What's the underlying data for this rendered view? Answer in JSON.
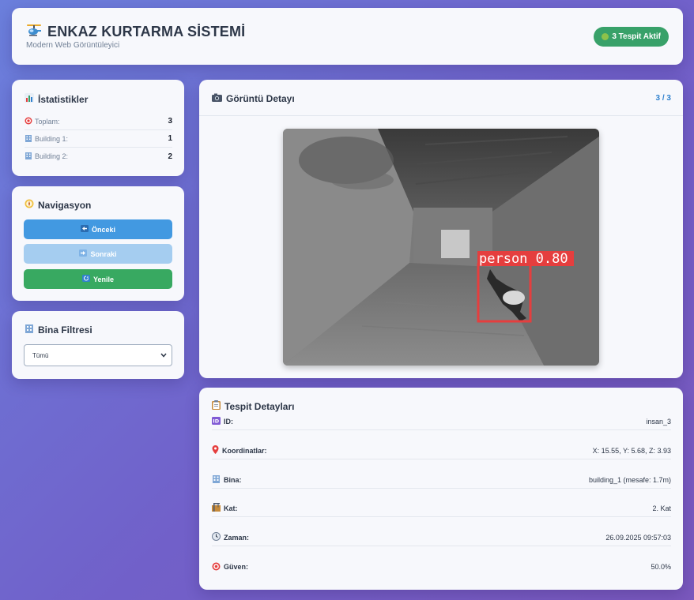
{
  "header": {
    "title": "ENKAZ KURTARMA SİSTEMİ",
    "subtitle": "Modern Web Görüntüleyici",
    "badge": "3 Tespit Aktif",
    "logo_icon": "helicopter-icon"
  },
  "stats": {
    "title": "İstatistikler",
    "rows": [
      {
        "label": "Toplam:",
        "value": "3",
        "icon": "target-icon"
      },
      {
        "label": "Building 1:",
        "value": "1",
        "icon": "building-icon"
      },
      {
        "label": "Building 2:",
        "value": "2",
        "icon": "building-icon"
      }
    ]
  },
  "navigation": {
    "title": "Navigasyon",
    "prev": "Önceki",
    "next": "Sonraki",
    "refresh": "Yenile"
  },
  "filter": {
    "title": "Bina Filtresi",
    "selected": "Tümü"
  },
  "viewer": {
    "title": "Görüntü Detayı",
    "counter": "3 / 3",
    "detection_label": "person 0.80"
  },
  "details": {
    "title": "Tespit Detayları",
    "rows": [
      {
        "key": "ID:",
        "value": "insan_3",
        "icon": "id-icon"
      },
      {
        "key": "Koordinatlar:",
        "value": "X: 15.55, Y: 5.68, Z: 3.93",
        "icon": "pin-icon"
      },
      {
        "key": "Bina:",
        "value": "building_1 (mesafe: 1.7m)",
        "icon": "building-icon"
      },
      {
        "key": "Kat:",
        "value": "2. Kat",
        "icon": "construction-icon"
      },
      {
        "key": "Zaman:",
        "value": "26.09.2025 09:57:03",
        "icon": "clock-icon"
      },
      {
        "key": "Güven:",
        "value": "50.0%",
        "icon": "target-icon"
      }
    ]
  },
  "colors": {
    "accent_blue": "#4299e1",
    "accent_green": "#38a169",
    "detection_red": "#e53e3e"
  }
}
